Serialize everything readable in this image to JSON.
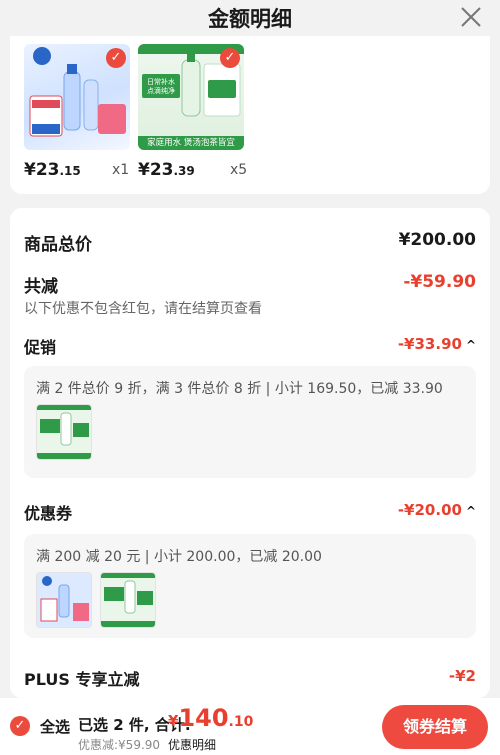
{
  "header": {
    "title": "金额明细"
  },
  "products": [
    {
      "price_int": "¥23",
      "price_dec": ".15",
      "qty": "x1",
      "thumb": "blue-water-pack"
    },
    {
      "price_int": "¥23",
      "price_dec": ".39",
      "qty": "x5",
      "thumb": "green-water-bottle",
      "banner": "日常补水 点滴纯净",
      "caption": "家庭用水 煲汤泡茶皆宜"
    }
  ],
  "summary": {
    "goods_total_label": "商品总价",
    "goods_total_value": "¥200.00",
    "total_reduce_label": "共减",
    "total_reduce_value": "-¥59.90",
    "note": "以下优惠不包含红包，请在结算页查看"
  },
  "promotion": {
    "label": "促销",
    "value": "-¥33.90",
    "line": "满 2 件总价 9 折，满 3 件总价 8 折 | 小计 169.50，已减 33.90"
  },
  "coupon": {
    "label": "优惠券",
    "value": "-¥20.00",
    "line": "满 200 减 20 元 | 小计 200.00，已减 20.00"
  },
  "plus": {
    "label": "PLUS 专享立减",
    "value": "-¥2"
  },
  "bottom_bar": {
    "select_all": "全选",
    "selected": "已选 2 件, 合计:",
    "total_yen": "¥",
    "total_int": "140",
    "total_dec": ".10",
    "discount": "优惠减:¥59.90",
    "detail_link": "优惠明细",
    "checkout": "领券结算"
  },
  "colors": {
    "accent": "#e8402f",
    "button": "#ee4a3f",
    "background": "#f2f2f2"
  }
}
